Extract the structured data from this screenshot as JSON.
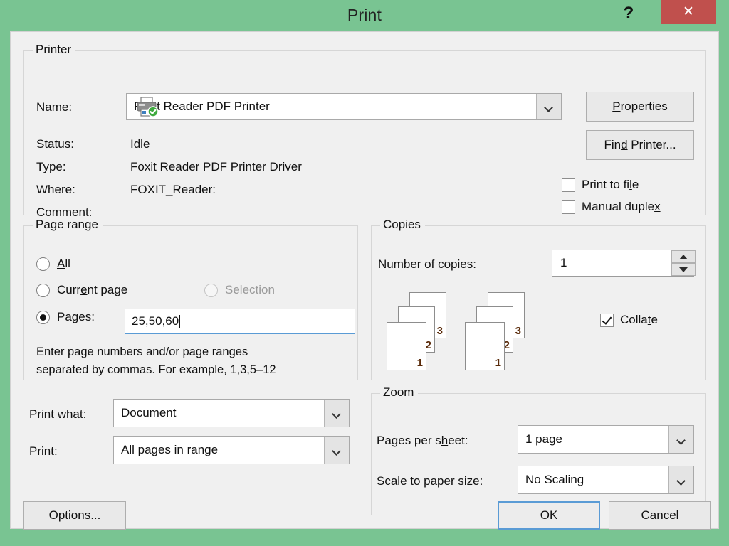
{
  "window": {
    "title": "Print",
    "help_label": "?",
    "close_label": "✕",
    "titlebar_color": "#79c492",
    "close_color": "#c0504d",
    "body_color": "#f0f0f0",
    "accent_color": "#5a9bd5"
  },
  "printer": {
    "legend": "Printer",
    "name_label": "Name:",
    "name_value": "Foxit Reader PDF Printer",
    "status_label": "Status:",
    "status_value": "Idle",
    "type_label": "Type:",
    "type_value": "Foxit Reader PDF Printer Driver",
    "where_label": "Where:",
    "where_value": "FOXIT_Reader:",
    "comment_label": "Comment:",
    "comment_value": "",
    "properties_button": "Properties",
    "find_printer_button": "Find Printer...",
    "print_to_file": {
      "label": "Print to file",
      "checked": false
    },
    "manual_duplex": {
      "label": "Manual duplex",
      "checked": false
    },
    "icon": "printer-default-icon"
  },
  "page_range": {
    "legend": "Page range",
    "options": [
      {
        "label": "All",
        "selected": false,
        "enabled": true
      },
      {
        "label": "Current page",
        "selected": false,
        "enabled": true
      },
      {
        "label": "Selection",
        "selected": false,
        "enabled": false
      },
      {
        "label": "Pages:",
        "selected": true,
        "enabled": true
      }
    ],
    "pages_value": "25,50,60",
    "hint_line1": "Enter page numbers and/or page ranges",
    "hint_line2": "separated by commas.  For example, 1,3,5–12"
  },
  "copies": {
    "legend": "Copies",
    "number_label": "Number of copies:",
    "number_value": "1",
    "collate": {
      "label": "Collate",
      "checked": true
    },
    "stack_page_numbers": [
      "3",
      "2",
      "1"
    ],
    "stack_count": 2
  },
  "print_what": {
    "what_label": "Print what:",
    "what_value": "Document",
    "print_label": "Print:",
    "print_value": "All pages in range"
  },
  "zoom": {
    "legend": "Zoom",
    "pages_per_sheet_label": "Pages per sheet:",
    "pages_per_sheet_value": "1 page",
    "scale_label": "Scale to paper size:",
    "scale_value": "No Scaling"
  },
  "footer": {
    "options_button": "Options...",
    "ok_button": "OK",
    "cancel_button": "Cancel"
  }
}
